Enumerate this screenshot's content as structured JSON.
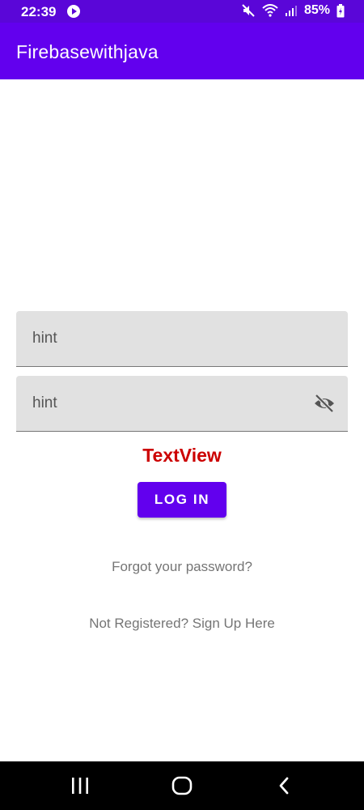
{
  "status_bar": {
    "time": "22:39",
    "battery": "85%",
    "icons": [
      "play-icon",
      "mute-icon",
      "wifi-icon",
      "signal-icon",
      "battery-icon"
    ]
  },
  "app_bar": {
    "title": "Firebasewithjava",
    "color": "#6200ee"
  },
  "form": {
    "email": {
      "placeholder": "hint",
      "value": ""
    },
    "password": {
      "placeholder": "hint",
      "value": "",
      "toggle_icon": "visibility-off-icon"
    },
    "status_text": "TextView",
    "status_color": "#cc0000",
    "login_label": "LOG IN",
    "forgot_label": "Forgot your password?",
    "signup_label": "Not Registered? Sign Up Here"
  },
  "nav_bar": {
    "icons": [
      "recents-icon",
      "home-icon",
      "back-icon"
    ]
  }
}
